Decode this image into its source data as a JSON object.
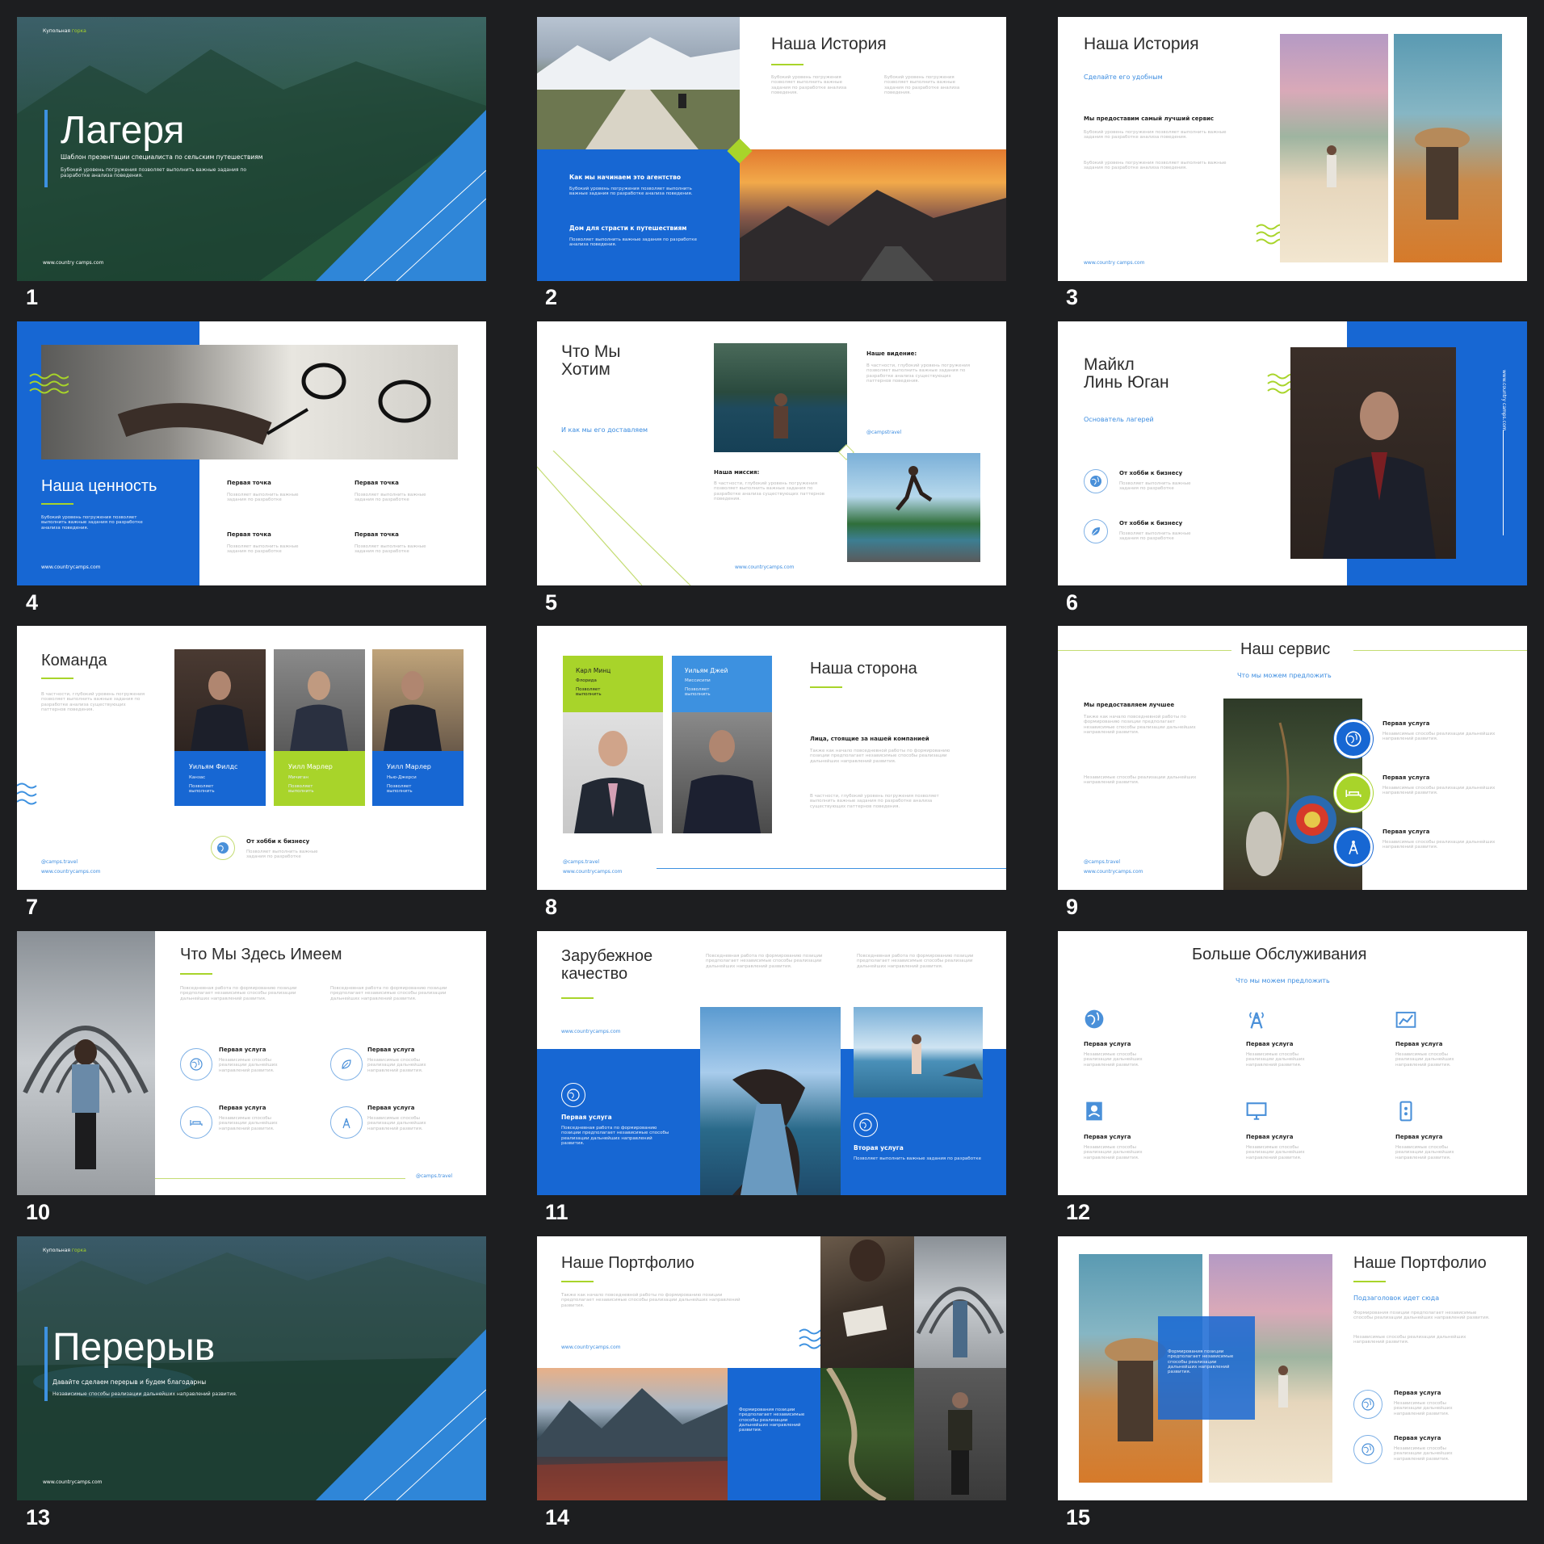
{
  "slide_numbers": [
    "1",
    "2",
    "3",
    "4",
    "5",
    "6",
    "7",
    "8",
    "9",
    "10",
    "11",
    "12",
    "13",
    "14",
    "15"
  ],
  "brand_a": "Купольная",
  "brand_b": "горка",
  "url": "www.country camps.com",
  "url2": "www.countrycamps.com",
  "handle": "@camps.travel",
  "handle2": "@campstravel",
  "s1": {
    "title": "Лагеря",
    "subtitle": "Шаблон презентации специалиста по сельским путешествиям",
    "text": "Бубокий уровень погружения позволяет выполнить важные задания по разработке анализа поведения."
  },
  "s2": {
    "title": "Наша История",
    "col1": "Бубокий уровень погружения позволяет выполнить важные задания по разработке анализа поведения.",
    "col2": "Бубокий уровень погружения позволяет выполнить важные задания по разработке анализа поведения.",
    "h1": "Как мы начинаем это агентство",
    "p1": "Бубокий уровень погружения позволяет выполнить важные задания по разработке анализа поведения.",
    "h2": "Дом для страсти к путешествиям",
    "p2": "Позволяет выполнить важные задания по разработке анализа поведения."
  },
  "s3": {
    "title": "Наша История",
    "subtitle": "Сделайте его удобным",
    "heading": "Мы предоставим самый лучший сервис",
    "p1": "Бубокий уровень погружения позволяет выполнить важные задания по разработке анализа поведения.",
    "p2": "Бубокий уровень погружения позволяет выполнить важные задания по разработке анализа поведения."
  },
  "s4": {
    "title": "Наша ценность",
    "text": "Бубокий уровень погружения позволяет выполнить важные задания по разработке анализа поведения.",
    "point": "Первая точка",
    "point_text": "Позволяет выполнить важные задания по разработке"
  },
  "s5": {
    "title": "Что Мы Хотим",
    "subtitle": "И как мы его доставляем",
    "vision": "Наше видение:",
    "vision_text": "В частности, глубокий уровень погружения позволяет выполнить важные задания по разработке анализа существующих паттернов поведения.",
    "mission": "Наша миссия:",
    "mission_text": "В частности, глубокий уровень погружения позволяет выполнить важные задания по разработке анализа существующих паттернов поведения."
  },
  "s6": {
    "name": "Майкл Линь Юган",
    "role": "Основатель лагерей",
    "item": "От хобби к бизнесу",
    "item_text": "Позволяет выполнить важные задания по разработке"
  },
  "s7": {
    "title": "Команда",
    "text": "В частности, глубокий уровень погружения позволяет выполнить важные задания по разработке анализа существующих паттернов поведения.",
    "members": [
      {
        "name": "Уильям Филдс",
        "place": "Канзас",
        "note": "Позволяет выполнить"
      },
      {
        "name": "Уилл Марлер",
        "place": "Мичиган",
        "note": "Позволяет выполнить"
      },
      {
        "name": "Уилл Марлер",
        "place": "Нью-Джерси",
        "note": "Позволяет выполнить"
      }
    ],
    "item": "От хобби к бизнесу",
    "item_text": "Позволяет выполнить важные задания по разработке"
  },
  "s8": {
    "title": "Наша сторона",
    "members": [
      {
        "name": "Карл Минц",
        "place": "Флорида",
        "note": "Позволяет выполнить"
      },
      {
        "name": "Уильям Джей",
        "place": "Миссисипи",
        "note": "Позволяет выполнить"
      }
    ],
    "heading": "Лица, стоящие за нашей компанией",
    "p1": "Также как начало повседневной работы по формированию позиции предполагает независимые способы реализации дальнейших направлений развития.",
    "p2": "В частности, глубокий уровень погружения позволяет выполнить важные задания по разработке анализа существующих паттернов поведения."
  },
  "s9": {
    "title": "Наш сервис",
    "subtitle": "Что мы можем предложить",
    "heading": "Мы предоставляем лучшее",
    "p1": "Также как начало повседневной работы по формированию позиции предполагает независимые способы реализации дальнейших направлений развития.",
    "p2": "Независимые способы реализации дальнейших направлений развития.",
    "service": "Первая услуга",
    "service_text": "Независимые способы реализации дальнейших направлений развития."
  },
  "s10": {
    "title": "Что Мы Здесь Имеем",
    "p": "Повседневная работа по формированию позиции предполагает независимые способы реализации дальнейших направлений развития.",
    "service": "Первая услуга",
    "service_text": "Независимые способы реализации дальнейших направлений развития."
  },
  "s11": {
    "title": "Зарубежное качество",
    "p": "Повседневная работа по формированию позиции предполагает независимые способы реализации дальнейших направлений развития.",
    "s1": "Первая услуга",
    "s1_text": "Повседневная работа по формированию позиции предполагает независимые способы реализации дальнейших направлений развития.",
    "s2": "Вторая услуга",
    "s2_text": "Позволяет выполнить важные задания по разработке"
  },
  "s12": {
    "title": "Больше Обслуживания",
    "subtitle": "Что мы можем предложить",
    "service": "Первая услуга",
    "service_text": "Независимые способы реализации дальнейших направлений развития."
  },
  "s13": {
    "title": "Перерыв",
    "subtitle": "Давайте сделаем перерыв и будем благодарны",
    "text": "Независимые способы реализации дальнейших направлений развития."
  },
  "s14": {
    "title": "Наше Портфолио",
    "p": "Также как начало повседневной работы по формированию позиции предполагает независимые способы реализации дальнейших направлений развития.",
    "box": "Формирования позиции предполагает независимые способы реализации дальнейших направлений развития."
  },
  "s15": {
    "title": "Наше Портфолио",
    "subtitle": "Подзаголовок идет сюда",
    "p1": "Формирования позиции предполагает независимые способы реализации дальнейших направлений развития.",
    "p2": "Независимые способы реализации дальнейших направлений развития.",
    "box": "Формирования позиции предполагает независимые способы реализации дальнейших направлений развития.",
    "service": "Первая услуга",
    "service_text": "Независимые способы реализации дальнейших направлений развития."
  },
  "colors": {
    "blue": "#1767d3",
    "light_blue": "#3d91e0",
    "lime": "#a8d42a",
    "background": "#1d1e20"
  },
  "icons": [
    "globe-icon",
    "leaf-icon",
    "bed-icon",
    "tower-icon",
    "chart-icon",
    "badge-icon",
    "monitor-icon",
    "phone-icon",
    "wave-icon"
  ]
}
